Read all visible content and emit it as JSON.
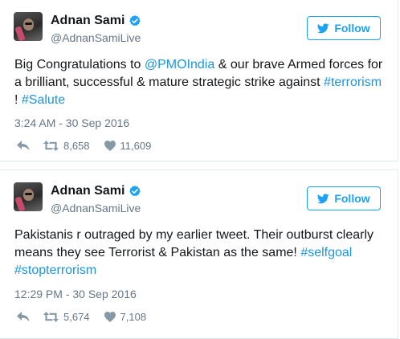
{
  "tweets": [
    {
      "author": "Adnan Sami",
      "handle": "@AdnanSamiLive",
      "follow_label": "Follow",
      "text": [
        {
          "t": "Big Congratulations to ",
          "link": false
        },
        {
          "t": "@PMOIndia",
          "link": true
        },
        {
          "t": " & our brave Armed forces for a brilliant, successful & mature strategic strike against ",
          "link": false
        },
        {
          "t": "#terrorism",
          "link": true
        },
        {
          "t": " ! ",
          "link": false
        },
        {
          "t": "#Salute",
          "link": true
        }
      ],
      "timestamp": "3:24 AM - 30 Sep 2016",
      "retweets": "8,658",
      "likes": "11,609"
    },
    {
      "author": "Adnan Sami",
      "handle": "@AdnanSamiLive",
      "follow_label": "Follow",
      "text": [
        {
          "t": "Pakistanis r outraged by my earlier tweet. Their outburst clearly means they see Terrorist & Pakistan as the same! ",
          "link": false
        },
        {
          "t": "#selfgoal",
          "link": true
        },
        {
          "t": " ",
          "link": false
        },
        {
          "t": "#stopterrorism",
          "link": true
        }
      ],
      "timestamp": "12:29 PM - 30 Sep 2016",
      "retweets": "5,674",
      "likes": "7,108"
    }
  ],
  "icons": {
    "verified": "verified-badge-icon",
    "bird": "twitter-bird-icon",
    "reply": "reply-icon",
    "retweet": "retweet-icon",
    "like": "heart-icon"
  },
  "colors": {
    "accent": "#1da1f2",
    "link": "#1b95e0",
    "muted": "#657786",
    "text": "#14171a",
    "border": "#e1e8ed"
  }
}
